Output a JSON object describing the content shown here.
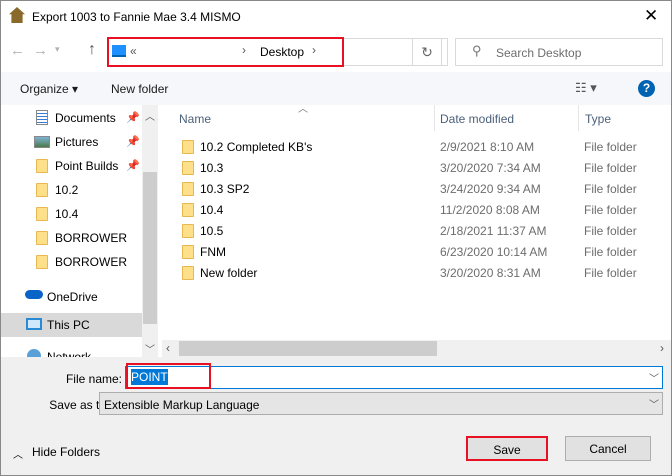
{
  "window": {
    "title": "Export 1003 to Fannie Mae 3.4 MISMO"
  },
  "address": {
    "prefix": "«",
    "current": "Desktop",
    "separator": "›"
  },
  "search": {
    "placeholder": "Search Desktop"
  },
  "toolbar": {
    "organize": "Organize ▾",
    "new_folder": "New folder",
    "help": "?"
  },
  "nav": {
    "items": [
      {
        "label": "Documents",
        "icon": "documents-icon",
        "pinned": true
      },
      {
        "label": "Pictures",
        "icon": "pictures-icon",
        "pinned": true
      },
      {
        "label": "Point Builds",
        "icon": "folder-icon",
        "pinned": true
      },
      {
        "label": "10.2",
        "icon": "folder-icon"
      },
      {
        "label": "10.4",
        "icon": "folder-icon"
      },
      {
        "label": "BORROWER",
        "icon": "folder-icon"
      },
      {
        "label": "BORROWER",
        "icon": "folder-icon"
      }
    ],
    "onedrive": "OneDrive",
    "this_pc": "This PC",
    "network": "Network"
  },
  "columns": {
    "name": "Name",
    "date": "Date modified",
    "type": "Type"
  },
  "files": [
    {
      "name": "10.2 Completed KB's",
      "date": "2/9/2021 8:10 AM",
      "type": "File folder"
    },
    {
      "name": "10.3",
      "date": "3/20/2020 7:34 AM",
      "type": "File folder"
    },
    {
      "name": "10.3 SP2",
      "date": "3/24/2020 9:34 AM",
      "type": "File folder"
    },
    {
      "name": "10.4",
      "date": "11/2/2020 8:08 AM",
      "type": "File folder"
    },
    {
      "name": "10.5",
      "date": "2/18/2021 11:37 AM",
      "type": "File folder"
    },
    {
      "name": "FNM",
      "date": "6/23/2020 10:14 AM",
      "type": "File folder"
    },
    {
      "name": "New folder",
      "date": "3/20/2020 8:31 AM",
      "type": "File folder"
    }
  ],
  "form": {
    "file_name_label": "File name:",
    "file_name_value": "POINT",
    "save_type_label": "Save as type:",
    "save_type_value": "Extensible Markup Language"
  },
  "footer": {
    "hide_folders": "Hide Folders",
    "save": "Save",
    "cancel": "Cancel"
  },
  "colors": {
    "highlight": "#e81123",
    "selection": "#0078d7",
    "accent": "#0063b1"
  }
}
